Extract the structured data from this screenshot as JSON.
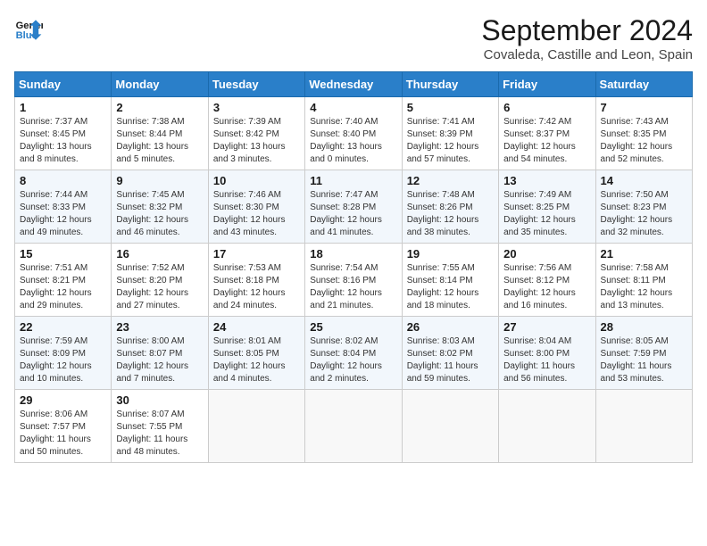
{
  "logo": {
    "line1": "General",
    "line2": "Blue"
  },
  "header": {
    "month": "September 2024",
    "location": "Covaleda, Castille and Leon, Spain"
  },
  "weekdays": [
    "Sunday",
    "Monday",
    "Tuesday",
    "Wednesday",
    "Thursday",
    "Friday",
    "Saturday"
  ],
  "weeks": [
    [
      {
        "day": "1",
        "sunrise": "Sunrise: 7:37 AM",
        "sunset": "Sunset: 8:45 PM",
        "daylight": "Daylight: 13 hours and 8 minutes."
      },
      {
        "day": "2",
        "sunrise": "Sunrise: 7:38 AM",
        "sunset": "Sunset: 8:44 PM",
        "daylight": "Daylight: 13 hours and 5 minutes."
      },
      {
        "day": "3",
        "sunrise": "Sunrise: 7:39 AM",
        "sunset": "Sunset: 8:42 PM",
        "daylight": "Daylight: 13 hours and 3 minutes."
      },
      {
        "day": "4",
        "sunrise": "Sunrise: 7:40 AM",
        "sunset": "Sunset: 8:40 PM",
        "daylight": "Daylight: 13 hours and 0 minutes."
      },
      {
        "day": "5",
        "sunrise": "Sunrise: 7:41 AM",
        "sunset": "Sunset: 8:39 PM",
        "daylight": "Daylight: 12 hours and 57 minutes."
      },
      {
        "day": "6",
        "sunrise": "Sunrise: 7:42 AM",
        "sunset": "Sunset: 8:37 PM",
        "daylight": "Daylight: 12 hours and 54 minutes."
      },
      {
        "day": "7",
        "sunrise": "Sunrise: 7:43 AM",
        "sunset": "Sunset: 8:35 PM",
        "daylight": "Daylight: 12 hours and 52 minutes."
      }
    ],
    [
      {
        "day": "8",
        "sunrise": "Sunrise: 7:44 AM",
        "sunset": "Sunset: 8:33 PM",
        "daylight": "Daylight: 12 hours and 49 minutes."
      },
      {
        "day": "9",
        "sunrise": "Sunrise: 7:45 AM",
        "sunset": "Sunset: 8:32 PM",
        "daylight": "Daylight: 12 hours and 46 minutes."
      },
      {
        "day": "10",
        "sunrise": "Sunrise: 7:46 AM",
        "sunset": "Sunset: 8:30 PM",
        "daylight": "Daylight: 12 hours and 43 minutes."
      },
      {
        "day": "11",
        "sunrise": "Sunrise: 7:47 AM",
        "sunset": "Sunset: 8:28 PM",
        "daylight": "Daylight: 12 hours and 41 minutes."
      },
      {
        "day": "12",
        "sunrise": "Sunrise: 7:48 AM",
        "sunset": "Sunset: 8:26 PM",
        "daylight": "Daylight: 12 hours and 38 minutes."
      },
      {
        "day": "13",
        "sunrise": "Sunrise: 7:49 AM",
        "sunset": "Sunset: 8:25 PM",
        "daylight": "Daylight: 12 hours and 35 minutes."
      },
      {
        "day": "14",
        "sunrise": "Sunrise: 7:50 AM",
        "sunset": "Sunset: 8:23 PM",
        "daylight": "Daylight: 12 hours and 32 minutes."
      }
    ],
    [
      {
        "day": "15",
        "sunrise": "Sunrise: 7:51 AM",
        "sunset": "Sunset: 8:21 PM",
        "daylight": "Daylight: 12 hours and 29 minutes."
      },
      {
        "day": "16",
        "sunrise": "Sunrise: 7:52 AM",
        "sunset": "Sunset: 8:20 PM",
        "daylight": "Daylight: 12 hours and 27 minutes."
      },
      {
        "day": "17",
        "sunrise": "Sunrise: 7:53 AM",
        "sunset": "Sunset: 8:18 PM",
        "daylight": "Daylight: 12 hours and 24 minutes."
      },
      {
        "day": "18",
        "sunrise": "Sunrise: 7:54 AM",
        "sunset": "Sunset: 8:16 PM",
        "daylight": "Daylight: 12 hours and 21 minutes."
      },
      {
        "day": "19",
        "sunrise": "Sunrise: 7:55 AM",
        "sunset": "Sunset: 8:14 PM",
        "daylight": "Daylight: 12 hours and 18 minutes."
      },
      {
        "day": "20",
        "sunrise": "Sunrise: 7:56 AM",
        "sunset": "Sunset: 8:12 PM",
        "daylight": "Daylight: 12 hours and 16 minutes."
      },
      {
        "day": "21",
        "sunrise": "Sunrise: 7:58 AM",
        "sunset": "Sunset: 8:11 PM",
        "daylight": "Daylight: 12 hours and 13 minutes."
      }
    ],
    [
      {
        "day": "22",
        "sunrise": "Sunrise: 7:59 AM",
        "sunset": "Sunset: 8:09 PM",
        "daylight": "Daylight: 12 hours and 10 minutes."
      },
      {
        "day": "23",
        "sunrise": "Sunrise: 8:00 AM",
        "sunset": "Sunset: 8:07 PM",
        "daylight": "Daylight: 12 hours and 7 minutes."
      },
      {
        "day": "24",
        "sunrise": "Sunrise: 8:01 AM",
        "sunset": "Sunset: 8:05 PM",
        "daylight": "Daylight: 12 hours and 4 minutes."
      },
      {
        "day": "25",
        "sunrise": "Sunrise: 8:02 AM",
        "sunset": "Sunset: 8:04 PM",
        "daylight": "Daylight: 12 hours and 2 minutes."
      },
      {
        "day": "26",
        "sunrise": "Sunrise: 8:03 AM",
        "sunset": "Sunset: 8:02 PM",
        "daylight": "Daylight: 11 hours and 59 minutes."
      },
      {
        "day": "27",
        "sunrise": "Sunrise: 8:04 AM",
        "sunset": "Sunset: 8:00 PM",
        "daylight": "Daylight: 11 hours and 56 minutes."
      },
      {
        "day": "28",
        "sunrise": "Sunrise: 8:05 AM",
        "sunset": "Sunset: 7:59 PM",
        "daylight": "Daylight: 11 hours and 53 minutes."
      }
    ],
    [
      {
        "day": "29",
        "sunrise": "Sunrise: 8:06 AM",
        "sunset": "Sunset: 7:57 PM",
        "daylight": "Daylight: 11 hours and 50 minutes."
      },
      {
        "day": "30",
        "sunrise": "Sunrise: 8:07 AM",
        "sunset": "Sunset: 7:55 PM",
        "daylight": "Daylight: 11 hours and 48 minutes."
      },
      null,
      null,
      null,
      null,
      null
    ]
  ]
}
